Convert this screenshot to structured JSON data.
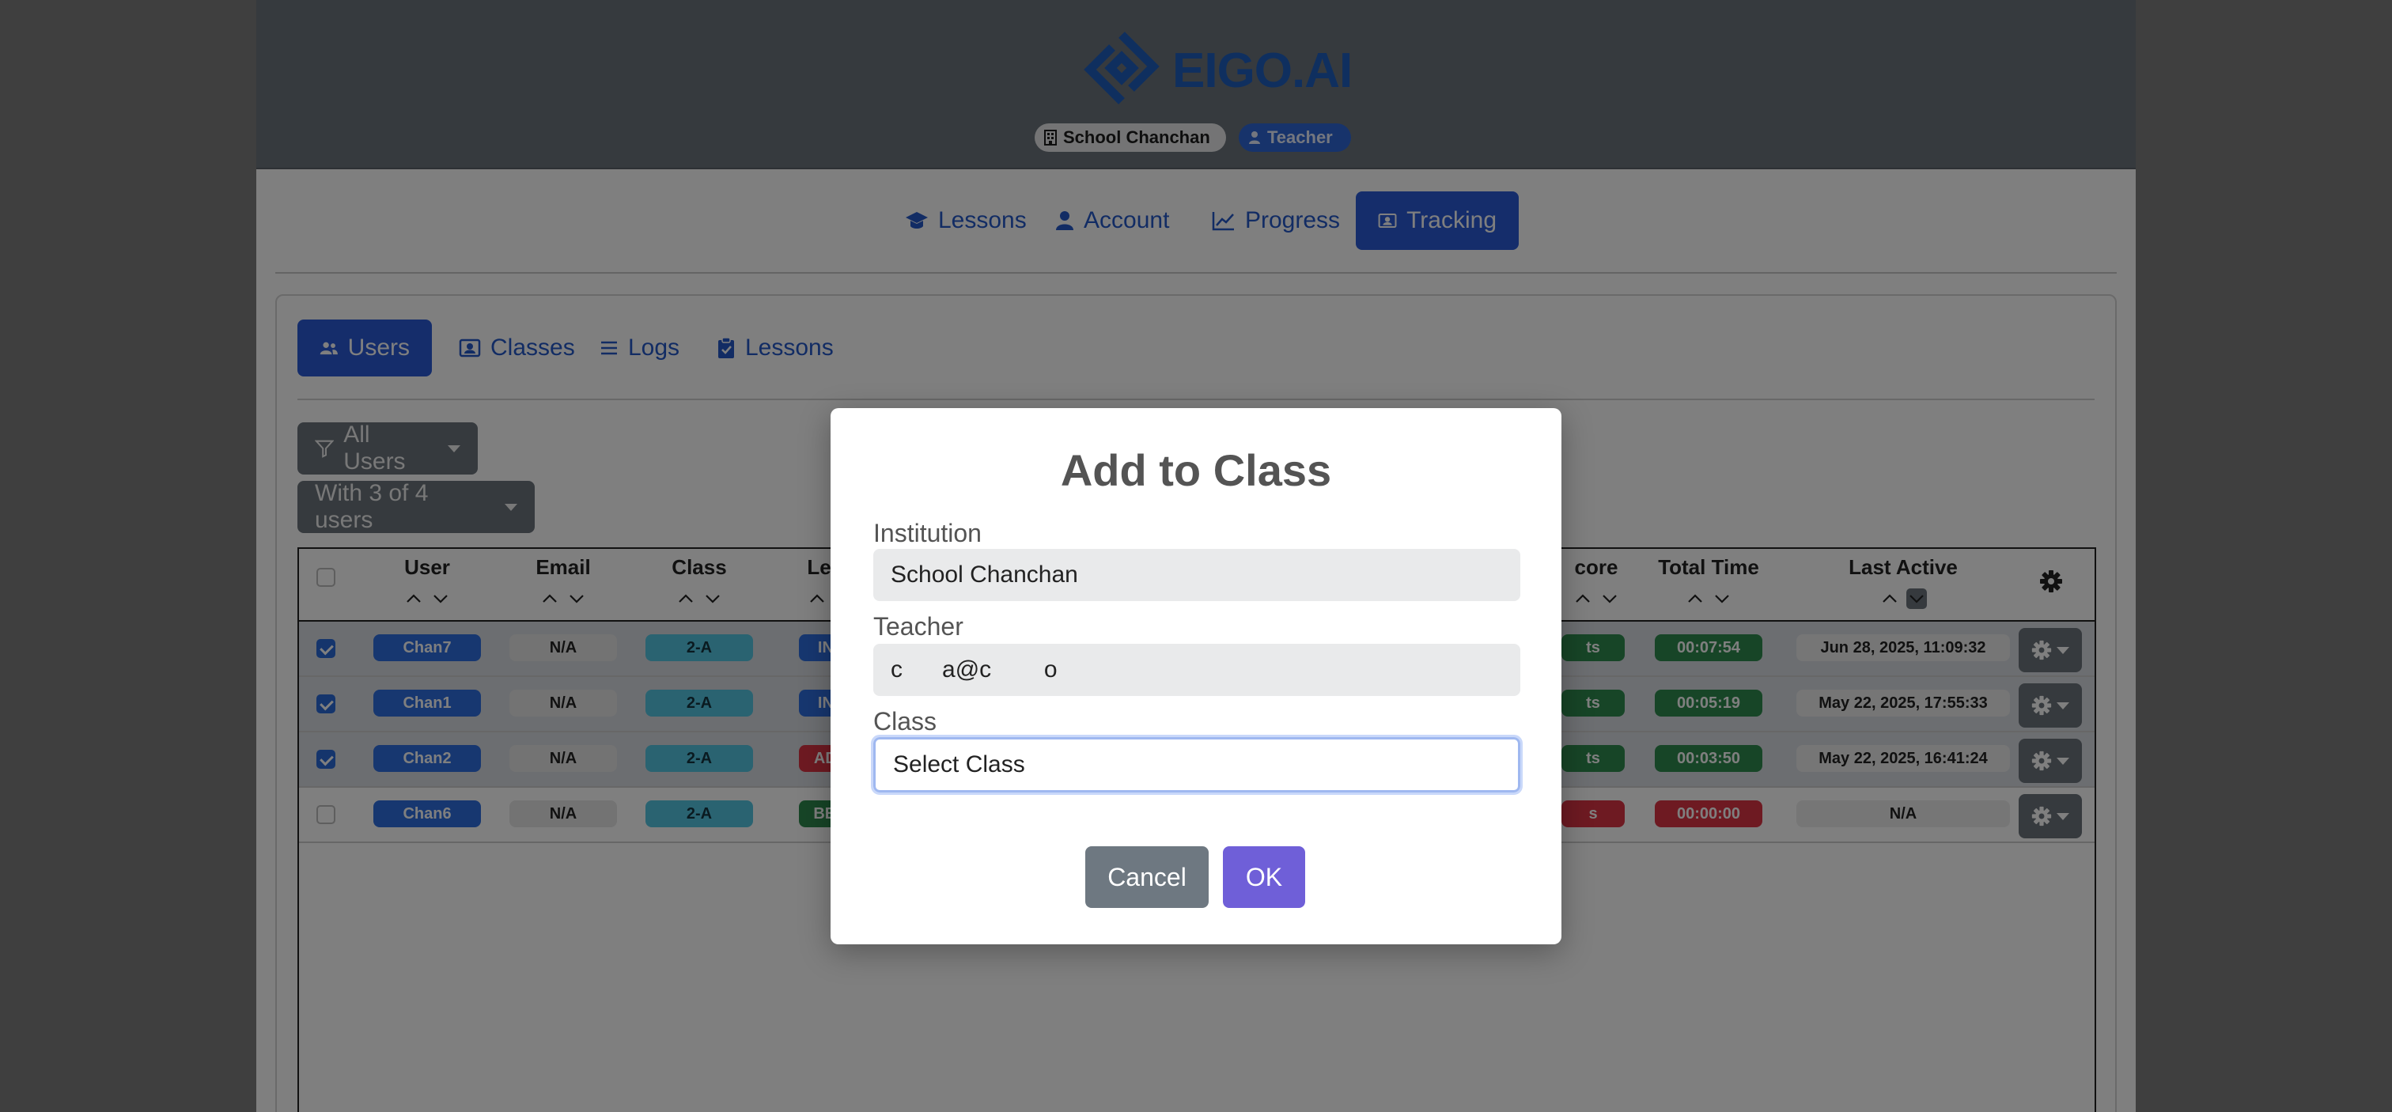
{
  "header": {
    "logo_text": "EIGO.AI",
    "institution_badge": "School Chanchan",
    "role_badge": "Teacher"
  },
  "main_nav": {
    "items": [
      {
        "label": "Lessons",
        "icon": "graduation-cap-icon"
      },
      {
        "label": "Account",
        "icon": "user-icon"
      },
      {
        "label": "Progress",
        "icon": "chart-line-icon"
      },
      {
        "label": "Tracking",
        "icon": "id-card-icon",
        "active": true
      }
    ]
  },
  "sub_nav": {
    "items": [
      {
        "label": "Users",
        "icon": "users-icon",
        "active": true
      },
      {
        "label": "Classes",
        "icon": "id-card-icon"
      },
      {
        "label": "Logs",
        "icon": "list-icon"
      },
      {
        "label": "Lessons",
        "icon": "clipboard-check-icon"
      }
    ]
  },
  "filters": {
    "users_filter": "All Users",
    "selection_action": "With 3 of 4 users"
  },
  "table": {
    "columns": [
      "User",
      "Email",
      "Class",
      "Level",
      "Score",
      "Total Time",
      "Last Active"
    ],
    "visible_header_fragments": {
      "level": "Leve",
      "score": "core"
    },
    "rows": [
      {
        "selected": true,
        "user": "Chan7",
        "email": "N/A",
        "class": "2-A",
        "level": "INT",
        "score_fragment": "ts",
        "total_time": "00:07:54",
        "last_active": "Jun 28, 2025, 11:09:32"
      },
      {
        "selected": true,
        "user": "Chan1",
        "email": "N/A",
        "class": "2-A",
        "level": "INT",
        "score_fragment": "ts",
        "total_time": "00:05:19",
        "last_active": "May 22, 2025, 17:55:33"
      },
      {
        "selected": true,
        "user": "Chan2",
        "email": "N/A",
        "class": "2-A",
        "level": "ADV",
        "score_fragment": "ts",
        "total_time": "00:03:50",
        "last_active": "May 22, 2025, 16:41:24"
      },
      {
        "selected": false,
        "user": "Chan6",
        "email": "N/A",
        "class": "2-A",
        "level": "BEG",
        "score_fragment": "s",
        "total_time": "00:00:00",
        "last_active": "N/A"
      }
    ]
  },
  "modal": {
    "title": "Add to Class",
    "institution_label": "Institution",
    "institution_value": "School Chanchan",
    "teacher_label": "Teacher",
    "teacher_value": "c      a@c        o",
    "class_label": "Class",
    "class_value": "Select Class",
    "cancel_label": "Cancel",
    "ok_label": "OK"
  },
  "colors": {
    "header_bg": "#6c757d",
    "primary": "#2a5bd7",
    "ok_button": "#6f5fd8",
    "cancel_button": "#6e7881"
  }
}
